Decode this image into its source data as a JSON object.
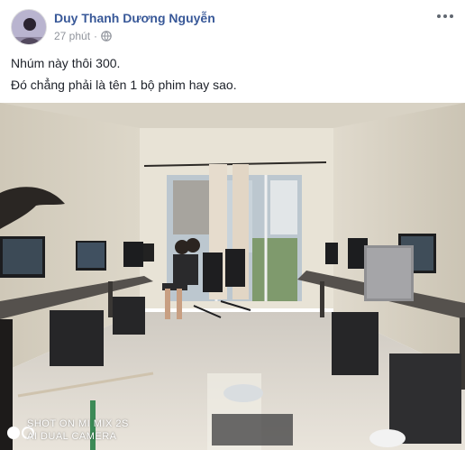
{
  "post": {
    "author": "Duy Thanh Dương Nguyễn",
    "time": "27 phút",
    "privacy_icon": "globe-icon",
    "lines": [
      "Nhúm này thôi 300.",
      "Đó chẳng phải là tên 1 bộ phim hay sao."
    ]
  },
  "photo": {
    "watermark_line1": "SHOT ON MI MIX 2S",
    "watermark_line2": "AI DUAL CAMERA"
  },
  "colors": {
    "author": "#385898",
    "meta": "#90949c",
    "text": "#1d2129"
  }
}
